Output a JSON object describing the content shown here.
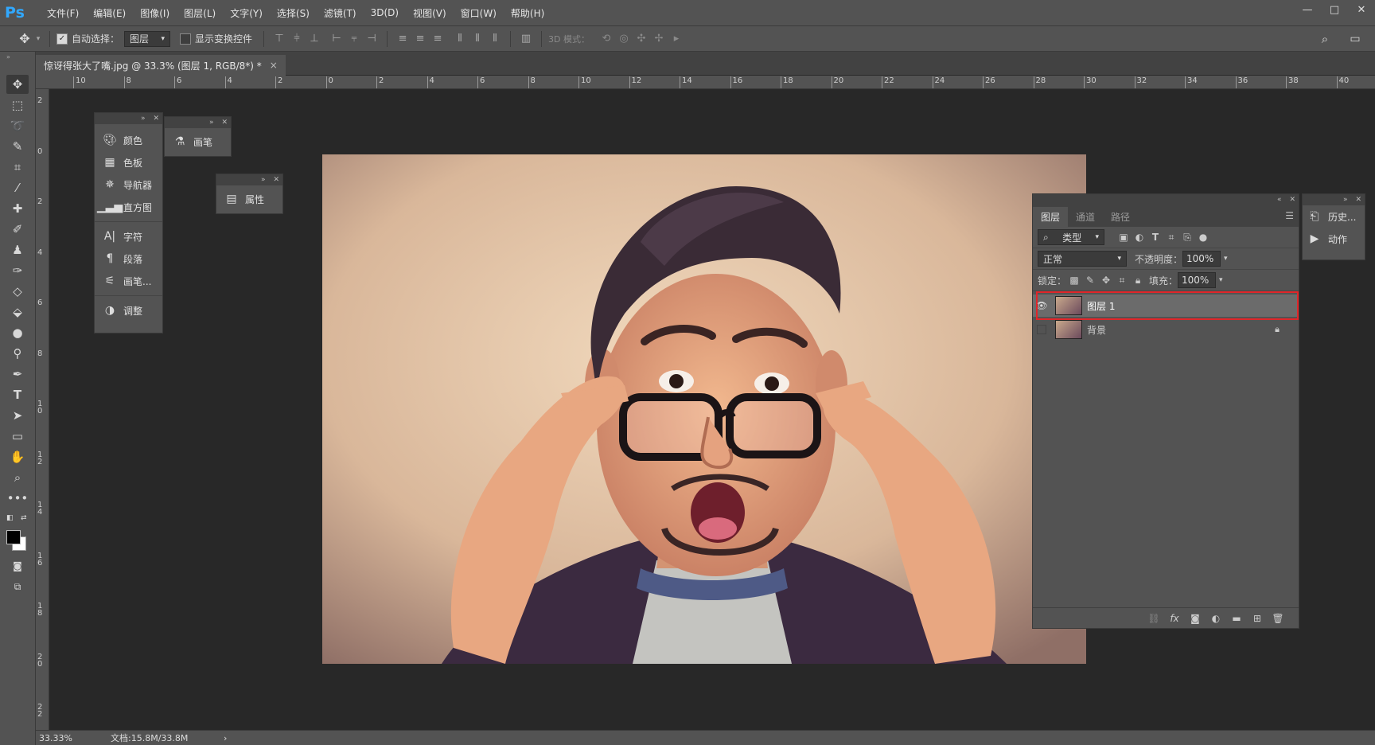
{
  "app": {
    "logo": "Ps"
  },
  "menu": [
    "文件(F)",
    "编辑(E)",
    "图像(I)",
    "图层(L)",
    "文字(Y)",
    "选择(S)",
    "滤镜(T)",
    "3D(D)",
    "视图(V)",
    "窗口(W)",
    "帮助(H)"
  ],
  "window_controls": {
    "minimize": "—",
    "maximize": "□",
    "close": "✕"
  },
  "options_bar": {
    "auto_select_label": "自动选择：",
    "auto_select_checked": true,
    "auto_select_target": "图层",
    "show_transform_label": "显示变换控件",
    "show_transform_checked": false,
    "mode_3d_label": "3D 模式："
  },
  "document": {
    "tab_title": "惊讶得张大了嘴.jpg @ 33.3% (图层 1, RGB/8*) *",
    "close": "×"
  },
  "rulers": {
    "top_labels": [
      "10",
      "8",
      "6",
      "4",
      "2",
      "0",
      "2",
      "4",
      "6",
      "8",
      "10",
      "12",
      "14",
      "16",
      "18",
      "20",
      "22",
      "24",
      "26",
      "28",
      "30",
      "32",
      "34",
      "36",
      "38",
      "40"
    ],
    "left_labels": [
      "2",
      "0",
      "2",
      "4",
      "6",
      "8",
      "1 0",
      "1 2",
      "1 4",
      "1 6",
      "1 8",
      "2 0",
      "2 2"
    ]
  },
  "status": {
    "zoom": "33.33%",
    "doc_info": "文档:15.8M/33.8M",
    "arrow": "›"
  },
  "panels": {
    "group1": {
      "items": [
        {
          "label": "颜色",
          "icon": "palette-icon"
        },
        {
          "label": "色板",
          "icon": "grid-icon"
        },
        {
          "label": "导航器",
          "icon": "navigator-icon"
        },
        {
          "label": "直方图",
          "icon": "histogram-icon"
        },
        {
          "label": "字符",
          "icon": "character-icon"
        },
        {
          "label": "段落",
          "icon": "paragraph-icon"
        },
        {
          "label": "画笔...",
          "icon": "brush-settings-icon"
        },
        {
          "label": "调整",
          "icon": "adjustments-icon"
        }
      ]
    },
    "brush": {
      "label": "画笔"
    },
    "properties": {
      "label": "属性"
    },
    "history": {
      "items": [
        {
          "label": "历史..."
        },
        {
          "label": "动作"
        }
      ]
    }
  },
  "layers_panel": {
    "tabs": [
      "图层",
      "通道",
      "路径"
    ],
    "active_tab": 0,
    "filter_label": "类型",
    "blend_mode": "正常",
    "opacity_label": "不透明度：",
    "opacity": "100%",
    "lock_label": "锁定：",
    "fill_label": "填充：",
    "fill": "100%",
    "layers": [
      {
        "name": "图层 1",
        "visible": true,
        "selected": true,
        "locked": false
      },
      {
        "name": "背景",
        "visible": false,
        "selected": false,
        "locked": true
      }
    ],
    "highlight_color": "#e0262a"
  },
  "colors": {
    "ui_bg": "#535353",
    "canvas_bg": "#282828",
    "logo_blue": "#31a8ff"
  }
}
